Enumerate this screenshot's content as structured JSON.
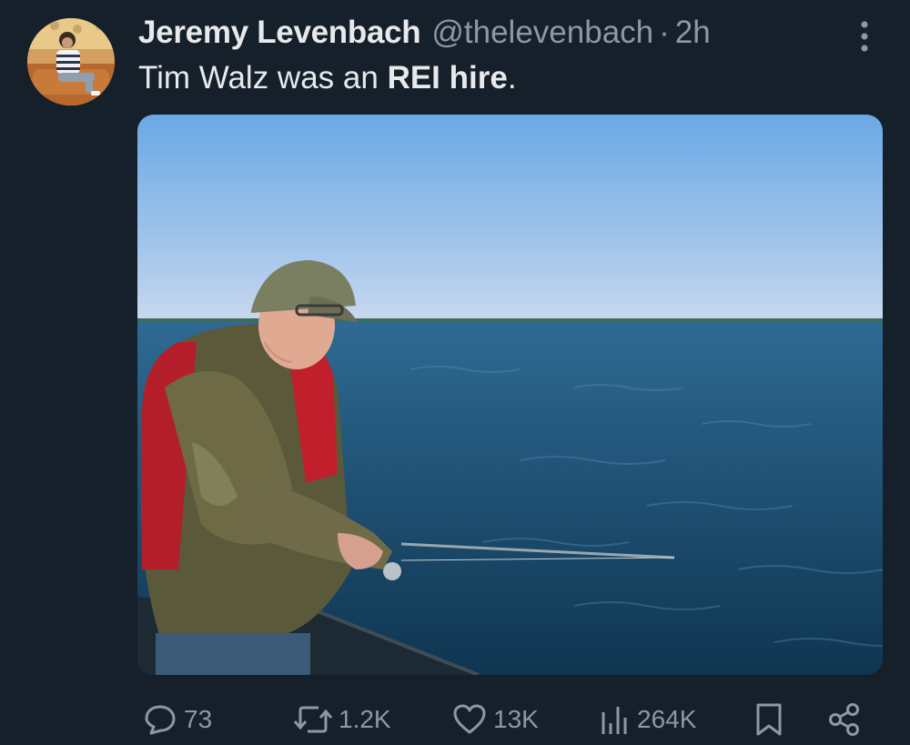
{
  "tweet": {
    "author": {
      "name": "Jeremy Levenbach",
      "handle": "@thelevenbach",
      "avatar_icon": "profile-avatar"
    },
    "separator": "·",
    "time": "2h",
    "text_prefix": "Tim Walz was an ",
    "text_bold": "REI hire",
    "text_suffix": ".",
    "media": {
      "icon": "photo-man-fishing-on-lake"
    },
    "stats": {
      "replies": "73",
      "reposts": "1.2K",
      "likes": "13K",
      "views": "264K"
    }
  },
  "colors": {
    "background": "#15202b",
    "text_primary": "#e7e9ea",
    "text_secondary": "#8b98a5"
  }
}
